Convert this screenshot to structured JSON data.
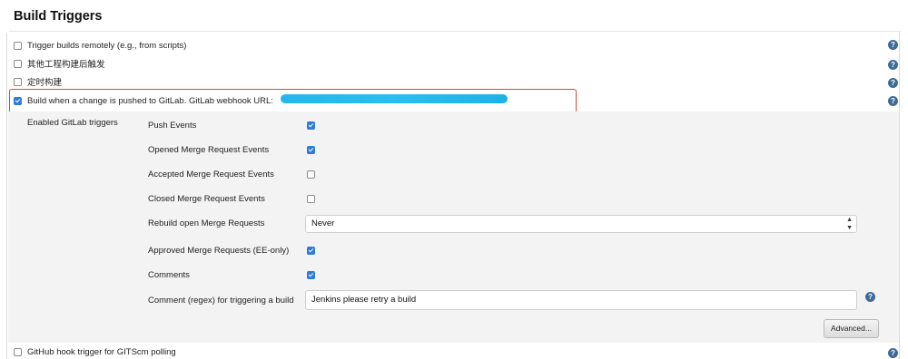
{
  "section": {
    "title": "Build Triggers"
  },
  "triggers": [
    {
      "label": "Trigger builds remotely (e.g., from scripts)",
      "checked": false
    },
    {
      "label": "其他工程构建后触发",
      "checked": false
    },
    {
      "label": "定时构建",
      "checked": false
    },
    {
      "label": "Build when a change is pushed to GitLab. GitLab webhook URL:",
      "checked": true
    }
  ],
  "gitlab": {
    "section_label": "Enabled GitLab triggers",
    "events": [
      {
        "label": "Push Events",
        "checked": true
      },
      {
        "label": "Opened Merge Request Events",
        "checked": true
      },
      {
        "label": "Accepted Merge Request Events",
        "checked": false
      },
      {
        "label": "Closed Merge Request Events",
        "checked": false
      }
    ],
    "rebuild_label": "Rebuild open Merge Requests",
    "rebuild_value": "Never",
    "approved_label": "Approved Merge Requests (EE-only)",
    "approved_checked": true,
    "comments_label": "Comments",
    "comments_checked": true,
    "comment_regex_label": "Comment (regex) for triggering a build",
    "comment_regex_value": "Jenkins please retry a build",
    "advanced_label": "Advanced..."
  },
  "github": {
    "label": "GitHub hook trigger for GITScm polling",
    "checked": false
  },
  "icons": {
    "help": "question-mark-icon",
    "select_arrow": "up-down-arrow-icon"
  },
  "colors": {
    "checkbox_checked": "#2f7bd8",
    "help_icon": "#3d6c98",
    "highlight": "#e0472c",
    "redaction": "#27b6ea"
  }
}
